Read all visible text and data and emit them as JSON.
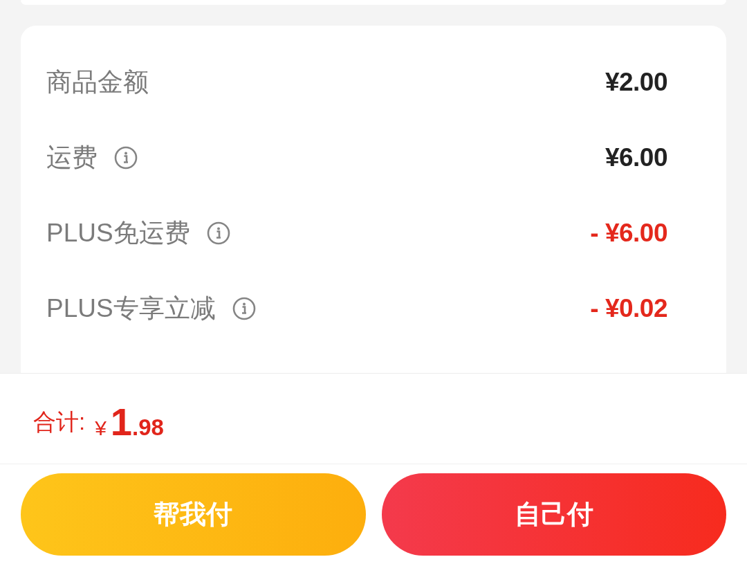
{
  "fee_rows": [
    {
      "label": "商品金额",
      "info": false,
      "kind": "charge",
      "value": "¥2.00"
    },
    {
      "label": "运费",
      "info": true,
      "kind": "charge",
      "value": "¥6.00"
    },
    {
      "label": "PLUS免运费",
      "info": true,
      "kind": "discount",
      "value": "- ¥6.00"
    },
    {
      "label": "PLUS专享立减",
      "info": true,
      "kind": "discount",
      "value": "- ¥0.02"
    }
  ],
  "total": {
    "label": "合计:",
    "currency": "¥",
    "integer": "1",
    "fraction": ".98"
  },
  "buttons": [
    {
      "label": "帮我付",
      "kind": "friend"
    },
    {
      "label": "自己付",
      "kind": "self"
    }
  ]
}
